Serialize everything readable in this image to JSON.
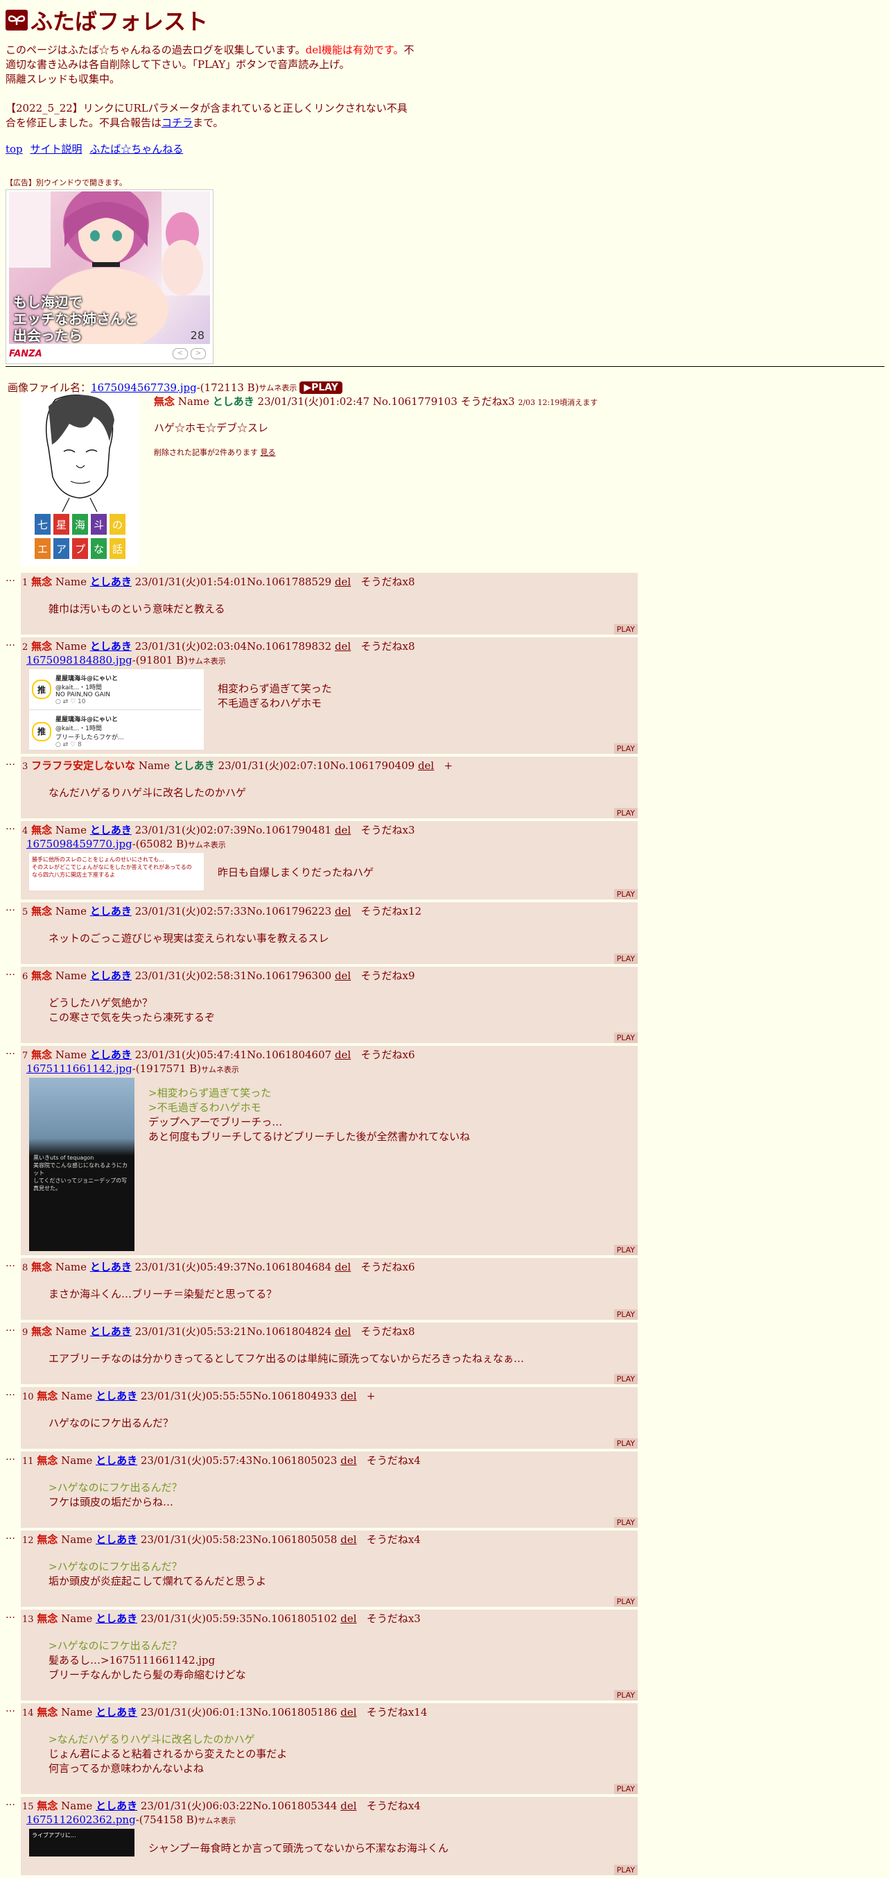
{
  "site": {
    "title": "ふたばフォレスト",
    "intro_1": "このページはふたば☆ちゃんねるの過去ログを収集しています。",
    "intro_del": "del機能は有効です。",
    "intro_2": "不適切な書き込みは各自削除して下さい。「PLAY」ボタンで音声読み上げ。",
    "intro_3": "隔離スレッドも収集中。",
    "notice": "【2022_5_22】リンクにURLパラメータが含まれていると正しくリンクされない不具合を修正しました。不具合報告は",
    "notice_link": "コチラ",
    "notice_end": "まで。",
    "nav": [
      "top",
      "サイト説明",
      "ふたば☆ちゃんねる"
    ]
  },
  "ad": {
    "note": "【広告】別ウインドウで開きます。",
    "text_1": "もし海辺で",
    "text_2": "エッチなお姉さんと",
    "text_3": "出会ったら",
    "page": "28",
    "brand": "FANZA",
    "prev": "<",
    "next": ">"
  },
  "op": {
    "file_label": "画像ファイル名：",
    "file_name": "1675094567739.jpg",
    "file_size": "-(172113 B)",
    "thumb_label": "サムネ表示",
    "play": "PLAY",
    "subject": "無念",
    "name_label": "Name",
    "name": "としあき",
    "date": "23/01/31(火)01:02:47",
    "no": "No.1061779103",
    "soudane": "そうだねx3",
    "expire": "2/03 12:19頃消えます",
    "text": "ハゲ☆ホモ☆デブ☆スレ",
    "deleted": "削除された記事が2件あります",
    "deleted_link": "見る",
    "thumb_tiles_top": [
      "七",
      "星",
      "海",
      "斗",
      "の"
    ],
    "thumb_tiles_bottom": [
      "エ",
      "ア",
      "プ",
      "な",
      "話"
    ]
  },
  "replies": [
    {
      "num": "1",
      "subject": "無念",
      "name": "としあき",
      "email": true,
      "date": "23/01/31(火)01:54:01",
      "no": "No.1061788529",
      "sod": "そうだねx8",
      "lines": [
        "雑巾は汚いものという意味だと教える"
      ]
    },
    {
      "num": "2",
      "subject": "無念",
      "name": "としあき",
      "email": true,
      "date": "23/01/31(火)02:03:04",
      "no": "No.1061789832",
      "sod": "そうだねx8",
      "file": "1675098184880.jpg",
      "fsize": "-(91801 B)",
      "lines": [
        "相変わらず過ぎて笑った",
        "不毛過ぎるわハゲホモ"
      ]
    },
    {
      "num": "3",
      "subject": "フラフラ安定しないな",
      "name": "としあき",
      "email": false,
      "date": "23/01/31(火)02:07:10",
      "no": "No.1061790409",
      "sod": "+",
      "lines": [
        "なんだハゲるりハゲ斗に改名したのかハゲ"
      ]
    },
    {
      "num": "4",
      "subject": "無念",
      "name": "としあき",
      "email": true,
      "date": "23/01/31(火)02:07:39",
      "no": "No.1061790481",
      "sod": "そうだねx3",
      "file": "1675098459770.jpg",
      "fsize": "-(65082 B)",
      "lines": [
        "昨日も自爆しまくりだったねハゲ"
      ]
    },
    {
      "num": "5",
      "subject": "無念",
      "name": "としあき",
      "email": true,
      "date": "23/01/31(火)02:57:33",
      "no": "No.1061796223",
      "sod": "そうだねx12",
      "lines": [
        "ネットのごっこ遊びじゃ現実は変えられない事を教えるスレ"
      ]
    },
    {
      "num": "6",
      "subject": "無念",
      "name": "としあき",
      "email": true,
      "date": "23/01/31(火)02:58:31",
      "no": "No.1061796300",
      "sod": "そうだねx9",
      "lines": [
        "どうしたハゲ気絶か？",
        "この寒さで気を失ったら凍死するぞ"
      ]
    },
    {
      "num": "7",
      "subject": "無念",
      "name": "としあき",
      "email": true,
      "date": "23/01/31(火)05:47:41",
      "no": "No.1061804607",
      "sod": "そうだねx6",
      "file": "1675111661142.jpg",
      "fsize": "-(1917571 B)",
      "quotes": [
        ">相変わらず過ぎて笑った",
        ">不毛過ぎるわハゲホモ"
      ],
      "lines": [
        "デップヘアーでブリーチっ…",
        "あと何度もブリーチしてるけどブリーチした後が全然書かれてないね"
      ]
    },
    {
      "num": "8",
      "subject": "無念",
      "name": "としあき",
      "email": true,
      "date": "23/01/31(火)05:49:37",
      "no": "No.1061804684",
      "sod": "そうだねx6",
      "lines": [
        "まさか海斗くん…ブリーチ＝染髪だと思ってる？"
      ]
    },
    {
      "num": "9",
      "subject": "無念",
      "name": "としあき",
      "email": true,
      "date": "23/01/31(火)05:53:21",
      "no": "No.1061804824",
      "sod": "そうだねx8",
      "lines": [
        "エアブリーチなのは分かりきってるとしてフケ出るのは単純に頭洗ってないからだろきったねぇなぁ…"
      ]
    },
    {
      "num": "10",
      "subject": "無念",
      "name": "としあき",
      "email": true,
      "date": "23/01/31(火)05:55:55",
      "no": "No.1061804933",
      "sod": "+",
      "lines": [
        "ハゲなのにフケ出るんだ？"
      ]
    },
    {
      "num": "11",
      "subject": "無念",
      "name": "としあき",
      "email": true,
      "date": "23/01/31(火)05:57:43",
      "no": "No.1061805023",
      "sod": "そうだねx4",
      "quotes": [
        ">ハゲなのにフケ出るんだ？"
      ],
      "lines": [
        "フケは頭皮の垢だからね…"
      ]
    },
    {
      "num": "12",
      "subject": "無念",
      "name": "としあき",
      "email": true,
      "date": "23/01/31(火)05:58:23",
      "no": "No.1061805058",
      "sod": "そうだねx4",
      "quotes": [
        ">ハゲなのにフケ出るんだ？"
      ],
      "lines": [
        "垢か頭皮が炎症起こして爛れてるんだと思うよ"
      ]
    },
    {
      "num": "13",
      "subject": "無念",
      "name": "としあき",
      "email": true,
      "date": "23/01/31(火)05:59:35",
      "no": "No.1061805102",
      "sod": "そうだねx3",
      "quotes": [
        ">ハゲなのにフケ出るんだ？"
      ],
      "lines": [
        "髪あるし…>1675111661142.jpg",
        "ブリーチなんかしたら髪の寿命縮むけどな"
      ]
    },
    {
      "num": "14",
      "subject": "無念",
      "name": "としあき",
      "email": true,
      "date": "23/01/31(火)06:01:13",
      "no": "No.1061805186",
      "sod": "そうだねx14",
      "quotes": [
        ">なんだハゲるりハゲ斗に改名したのかハゲ"
      ],
      "lines": [
        "じょん君によると粘着されるから変えたとの事だよ",
        "何言ってるか意味わかんないよね"
      ]
    },
    {
      "num": "15",
      "subject": "無念",
      "name": "としあき",
      "email": true,
      "date": "23/01/31(火)06:03:22",
      "no": "No.1061805344",
      "sod": "そうだねx4",
      "file": "1675112602362.png",
      "fsize": "-(754158 B)",
      "lines": [
        "シャンプー毎食時とか言って頭洗ってないから不潔なお海斗くん"
      ]
    }
  ],
  "labels": {
    "name": "Name",
    "del": "del",
    "play": "PLAY",
    "thumb": "サムネ表示"
  },
  "tweets": {
    "name": "星屋璃海斗@にゃいと",
    "handle": "@kait...・1時間",
    "t1": "NO PAIN,NO GAIN",
    "t2": "ブリーチしたらフケが...",
    "badge": "推",
    "likes1": "10",
    "likes2": "8"
  },
  "thumb4": {
    "l1": "勝手に他所のスレのことをじょんのせいにされても...",
    "l2": "そのスレがどこでじょんがなにをしたか答えてそれがあってるの",
    "l3": "なら四六八方に開店土下座するよ"
  },
  "thumb7": {
    "l1": "黒いきuts of tequagon",
    "l2": "美容院でこんな感じになれるようにカット",
    "l3": "してくださいってジョニーデップの写真見せた。"
  },
  "thumb15": {
    "title": "ライブアプリに..."
  },
  "colors": {
    "bg": "#ffffee",
    "reply_bg": "#f0e0d6",
    "text": "#800000",
    "subject": "#cc1105",
    "name": "#117743",
    "quote": "#789922"
  }
}
